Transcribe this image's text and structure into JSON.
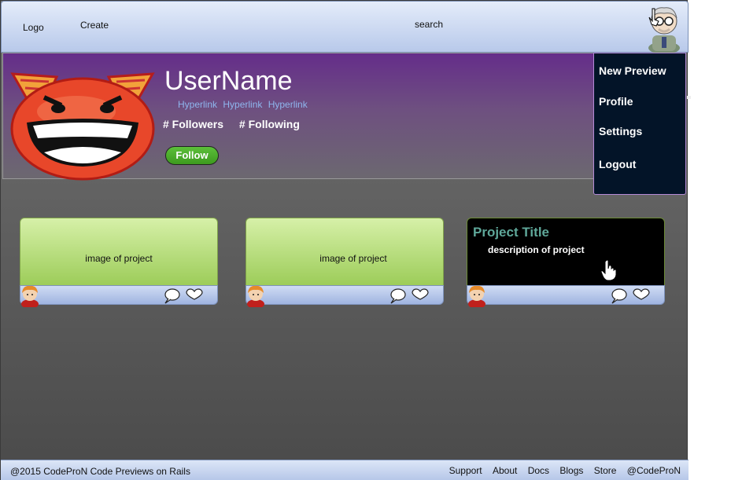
{
  "header": {
    "logo": "Logo",
    "create": "Create",
    "search": "search"
  },
  "profile": {
    "username": "UserName",
    "links": [
      "Hyperlink",
      "Hyperlink",
      "Hyperlink"
    ],
    "followers": "# Followers",
    "following": "# Following",
    "follow_button": "Follow"
  },
  "dropdown": {
    "items": [
      "New Preview",
      "Profile",
      "Settings",
      "Logout"
    ]
  },
  "projects": [
    {
      "caption": "image of project"
    },
    {
      "caption": "image of project"
    },
    {
      "title": "Project Title",
      "description": "description of project"
    }
  ],
  "footer": {
    "copyright": "@2015 CodeProN Code Previews on Rails",
    "links": [
      "Support",
      "About",
      "Docs",
      "Blogs",
      "Store",
      "@CodeProN"
    ]
  },
  "colors": {
    "banner_top": "#652d8a",
    "menu_bg": "#031428",
    "follow_green": "#4caf2c",
    "card_green": "#b8e07a",
    "project_title": "#5fa89a",
    "link_blue": "#8fb6ee"
  }
}
